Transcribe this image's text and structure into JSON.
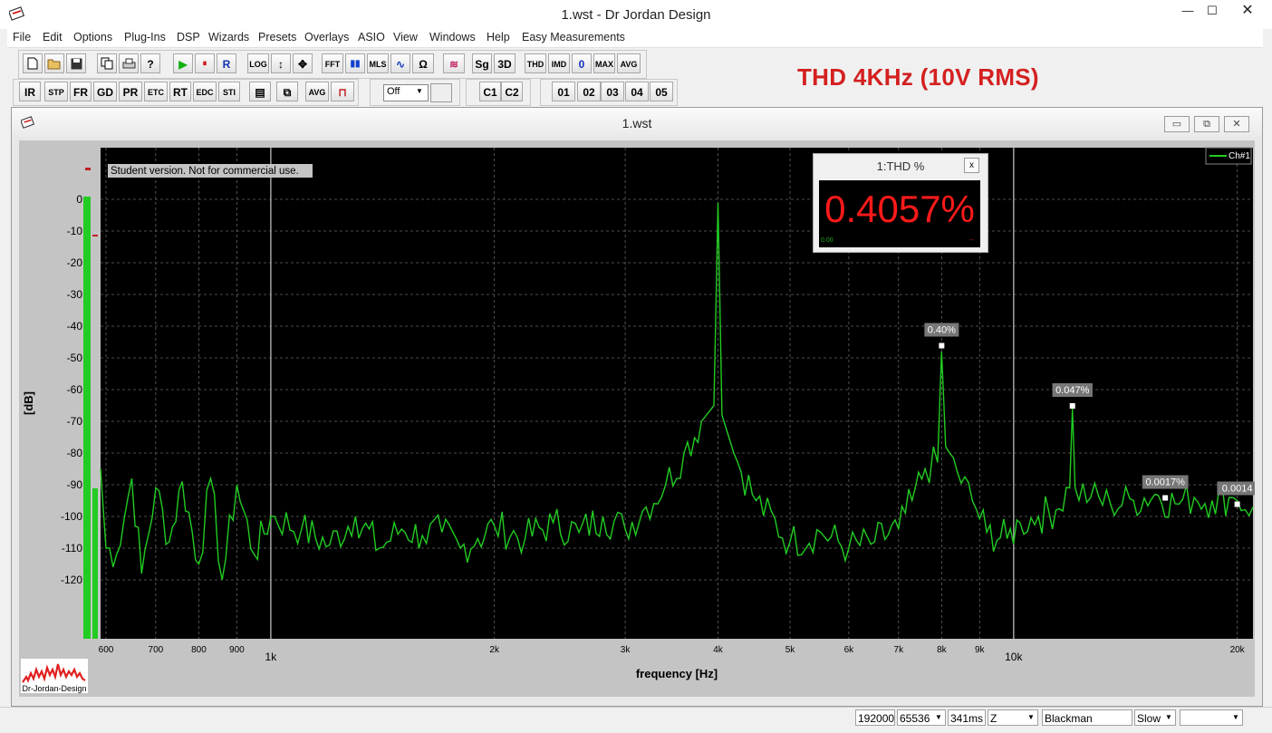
{
  "window": {
    "title": "1.wst - Dr Jordan Design",
    "minimize": "—",
    "maximize": "☐",
    "close": "✕"
  },
  "menu": [
    "File",
    "Edit",
    "Options",
    "Plug-Ins",
    "DSP",
    "Wizards",
    "Presets",
    "Overlays",
    "ASIO",
    "View",
    "Windows",
    "Help",
    "Easy Measurements"
  ],
  "toolbar1": {
    "file_icons": [
      "new-icon",
      "open-icon",
      "save-icon",
      "copy-icon",
      "print-icon",
      "help-icon"
    ],
    "transport": {
      "play": "▶",
      "pause": "⏸",
      "record": "R"
    },
    "tools": [
      "LOG",
      "↕",
      "✥"
    ],
    "analysis": [
      "FFT",
      "▮▮",
      "MLS",
      "∿",
      "Ω",
      "≋",
      "Sg",
      "3D",
      "THD",
      "IMD",
      "0",
      "MAX",
      "AVG"
    ]
  },
  "toolbar2": {
    "buttons": [
      "IR",
      "STP",
      "FR",
      "GD",
      "PR",
      "ETC",
      "RT",
      "EDC",
      "STI"
    ],
    "extra": [
      "▤",
      "⧉",
      "AVG",
      "⊓"
    ],
    "select_value": "Off",
    "channels": [
      "C1",
      "C2"
    ],
    "presets": [
      "01",
      "02",
      "03",
      "04",
      "05"
    ]
  },
  "headline": "THD 4KHz (10V RMS)",
  "child_window": {
    "title": "1.wst",
    "buttons": [
      "▭",
      "⧉",
      "✕"
    ]
  },
  "plot": {
    "notice": "Student version. Not for commercial use.",
    "legend": "Ch#1",
    "logo": "Dr-Jordan-Design",
    "thd_panel": {
      "title": "1:THD %",
      "close": "x",
      "value": "0.4057%",
      "left_small": "0.00",
      "right_small": "--"
    },
    "harmonic_labels": [
      "0.40%",
      "0.047%",
      "0.0017%",
      "0.0014"
    ],
    "colors": {
      "trace": "#22cc22",
      "background": "#000000",
      "thd_value": "#ff1a1a",
      "headline": "#d42020"
    }
  },
  "chart_data": {
    "type": "line",
    "xlabel": "frequency [Hz]",
    "ylabel": "[dB]",
    "x_scale": "log",
    "xlim": [
      590,
      21000
    ],
    "ylim": [
      -140,
      5
    ],
    "y_ticks": [
      0,
      -10,
      -20,
      -30,
      -40,
      -50,
      -60,
      -70,
      -80,
      -90,
      -100,
      -110,
      -120
    ],
    "x_ticks": [
      {
        "value": 600,
        "label": "600"
      },
      {
        "value": 700,
        "label": "700"
      },
      {
        "value": 800,
        "label": "800"
      },
      {
        "value": 900,
        "label": "900"
      },
      {
        "value": 1000,
        "label": "1k"
      },
      {
        "value": 2000,
        "label": "2k"
      },
      {
        "value": 3000,
        "label": "3k"
      },
      {
        "value": 4000,
        "label": "4k"
      },
      {
        "value": 5000,
        "label": "5k"
      },
      {
        "value": 6000,
        "label": "6k"
      },
      {
        "value": 7000,
        "label": "7k"
      },
      {
        "value": 8000,
        "label": "8k"
      },
      {
        "value": 9000,
        "label": "9k"
      },
      {
        "value": 10000,
        "label": "10k"
      },
      {
        "value": 20000,
        "label": "20k"
      }
    ],
    "grid": true,
    "series": [
      {
        "name": "Ch#1",
        "points": [
          [
            590,
            -85
          ],
          [
            600,
            -110
          ],
          [
            620,
            -112
          ],
          [
            650,
            -88
          ],
          [
            670,
            -118
          ],
          [
            700,
            -91
          ],
          [
            730,
            -108
          ],
          [
            760,
            -89
          ],
          [
            800,
            -115
          ],
          [
            830,
            -88
          ],
          [
            860,
            -120
          ],
          [
            900,
            -90
          ],
          [
            950,
            -112
          ],
          [
            1000,
            -100
          ],
          [
            1100,
            -104
          ],
          [
            1200,
            -109
          ],
          [
            1300,
            -100
          ],
          [
            1400,
            -110
          ],
          [
            1500,
            -104
          ],
          [
            1600,
            -106
          ],
          [
            1700,
            -105
          ],
          [
            1800,
            -110
          ],
          [
            1900,
            -107
          ],
          [
            2000,
            -103
          ],
          [
            2200,
            -107
          ],
          [
            2400,
            -102
          ],
          [
            2600,
            -105
          ],
          [
            2800,
            -100
          ],
          [
            3000,
            -104
          ],
          [
            3200,
            -97
          ],
          [
            3400,
            -90
          ],
          [
            3600,
            -80
          ],
          [
            3800,
            -70
          ],
          [
            3950,
            -65
          ],
          [
            4000,
            -1
          ],
          [
            4050,
            -68
          ],
          [
            4200,
            -80
          ],
          [
            4500,
            -95
          ],
          [
            5000,
            -108
          ],
          [
            5500,
            -105
          ],
          [
            6000,
            -110
          ],
          [
            6500,
            -108
          ],
          [
            7000,
            -104
          ],
          [
            7300,
            -95
          ],
          [
            7600,
            -85
          ],
          [
            7900,
            -83
          ],
          [
            8000,
            -48
          ],
          [
            8100,
            -78
          ],
          [
            8400,
            -86
          ],
          [
            8800,
            -95
          ],
          [
            9200,
            -105
          ],
          [
            9800,
            -107
          ],
          [
            10200,
            -102
          ],
          [
            10800,
            -100
          ],
          [
            11400,
            -98
          ],
          [
            11900,
            -91
          ],
          [
            12000,
            -66
          ],
          [
            12100,
            -91
          ],
          [
            12700,
            -94
          ],
          [
            13500,
            -96
          ],
          [
            14500,
            -95
          ],
          [
            15500,
            -93
          ],
          [
            16500,
            -96
          ],
          [
            17500,
            -94
          ],
          [
            18500,
            -95
          ],
          [
            19500,
            -94
          ],
          [
            20000,
            -95
          ],
          [
            21000,
            -97
          ]
        ]
      }
    ],
    "harmonics": [
      {
        "x": 8000,
        "y": -47,
        "label": "0.40%"
      },
      {
        "x": 12000,
        "y": -66,
        "label": "0.047%"
      },
      {
        "x": 16000,
        "y": -95,
        "label": "0.0017%"
      },
      {
        "x": 20000,
        "y": -97,
        "label": "0.0014"
      }
    ]
  },
  "status": {
    "sample_rate": "192000",
    "fft_size": "65536",
    "duration": "341ms",
    "mode": "Z",
    "window_fn": "Blackman",
    "speed": "Slow",
    "extra": ""
  }
}
